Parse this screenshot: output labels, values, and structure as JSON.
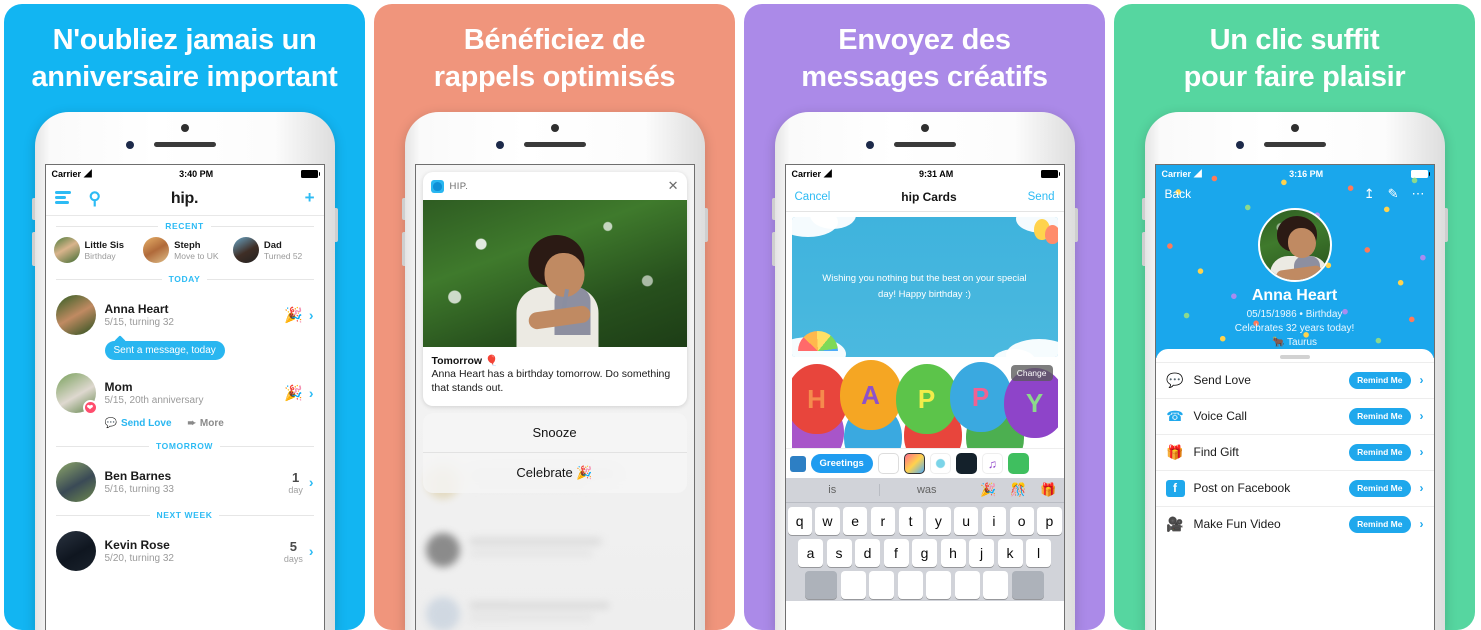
{
  "panels": [
    {
      "bg": "#12b5f2",
      "title": "N'oubliez jamais un\nanniversaire important",
      "statusbar": {
        "carrier": "Carrier",
        "wifi_icon": "wifi-icon",
        "time": "3:40 PM",
        "battery_icon": "battery-full-icon"
      },
      "navbar": {
        "menu_icon": "menu-lines-icon",
        "search_icon": "search-icon",
        "brand": "hip.",
        "add_icon": "plus-icon"
      },
      "sections": {
        "recent": "RECENT",
        "today": "TODAY",
        "tomorrow": "TOMORROW",
        "next_week": "NEXT WEEK"
      },
      "recents": [
        {
          "name": "Little Sis",
          "sub": "Birthday"
        },
        {
          "name": "Steph",
          "sub": "Move to UK"
        },
        {
          "name": "Dad",
          "sub": "Turned 52"
        }
      ],
      "entries": [
        {
          "name": "Anna Heart",
          "sub": "5/15, turning 32",
          "emoji": "🎉",
          "bubble": "Sent a message, today",
          "chevron": "›"
        },
        {
          "name": "Mom",
          "sub": "5/15, 20th anniversary",
          "emoji": "🎉",
          "chevron": "›",
          "actions": [
            {
              "label": "Send Love",
              "icon": "chat-bubble-icon"
            },
            {
              "label": "More",
              "icon": "share-arrow-icon"
            }
          ]
        },
        {
          "name": "Ben Barnes",
          "sub": "5/16, turning 33",
          "count": "1",
          "unit": "day",
          "chevron": "›"
        },
        {
          "name": "Kevin Rose",
          "sub": "5/20, turning 32",
          "count": "5",
          "unit": "days",
          "chevron": "›"
        }
      ]
    },
    {
      "bg": "#f0957c",
      "title": "Bénéficiez de\nrappels optimisés",
      "notification": {
        "app_icon": "hip-app-icon",
        "app_name": "HIP.",
        "close_icon": "close-icon",
        "title": "Tomorrow",
        "title_emoji": "🎈",
        "body": "Anna Heart has a birthday tomorrow. Do something that stands out."
      },
      "quick_actions": [
        {
          "label": "Snooze"
        },
        {
          "label": "Celebrate 🎉"
        }
      ]
    },
    {
      "bg": "#ab8ae8",
      "title": "Envoyez des\nmessages créatifs",
      "statusbar": {
        "carrier": "Carrier",
        "wifi_icon": "wifi-icon",
        "time": "9:31 AM",
        "battery_icon": "battery-full-icon"
      },
      "navbar": {
        "cancel": "Cancel",
        "title": "hip Cards",
        "send": "Send"
      },
      "card": {
        "message": "Wishing you nothing but the best on your special day! Happy birthday :)"
      },
      "balloons": {
        "letters": [
          "H",
          "A",
          "P",
          "P",
          "Y"
        ],
        "change_label": "Change"
      },
      "toolbar": {
        "greetings": "Greetings",
        "apps_icon": "app-store-icon"
      },
      "keyboard": {
        "predictions": [
          "is",
          "was"
        ],
        "prediction_emojis": [
          "🎉",
          "🎊",
          "🎁"
        ],
        "row1": [
          "q",
          "w",
          "e",
          "r",
          "t",
          "y",
          "u",
          "i",
          "o",
          "p"
        ],
        "row2": [
          "a",
          "s",
          "d",
          "f",
          "g",
          "h",
          "j",
          "k",
          "l"
        ]
      }
    },
    {
      "bg": "#56d6a0",
      "title": "Un clic suffit\npour faire plaisir",
      "statusbar": {
        "carrier": "Carrier",
        "wifi_icon": "wifi-icon",
        "time": "3:16 PM",
        "battery_icon": "battery-full-icon"
      },
      "navbar": {
        "back": "Back",
        "share_icon": "share-upload-icon",
        "edit_icon": "compose-edit-icon",
        "more_icon": "more-dots-icon"
      },
      "profile": {
        "name": "Anna Heart",
        "meta": "05/15/1986 • Birthday",
        "celebrates": "Celebrates 32 years today!",
        "sign_emoji": "🐂",
        "sign": "Taurus"
      },
      "actions": [
        {
          "label": "Send Love",
          "icon": "chat-bubble-icon",
          "glyph": "💬",
          "button": "Remind Me",
          "chevron": "›"
        },
        {
          "label": "Voice Call",
          "icon": "phone-icon",
          "glyph": "📞",
          "button": "Remind Me",
          "chevron": "›"
        },
        {
          "label": "Find Gift",
          "icon": "gift-icon",
          "glyph": "🎁",
          "button": "Remind Me",
          "chevron": "›"
        },
        {
          "label": "Post on Facebook",
          "icon": "facebook-icon",
          "glyph": "f",
          "button": "Remind Me",
          "chevron": "›"
        },
        {
          "label": "Make Fun Video",
          "icon": "video-camera-icon",
          "glyph": "📹",
          "button": "Remind Me",
          "chevron": "›"
        }
      ]
    }
  ],
  "colors": {
    "brand_blue": "#29b6f0",
    "panel1_bg": "#12b5f2",
    "panel2_bg": "#f0957c",
    "panel3_bg": "#ab8ae8",
    "panel4_bg": "#56d6a0"
  }
}
